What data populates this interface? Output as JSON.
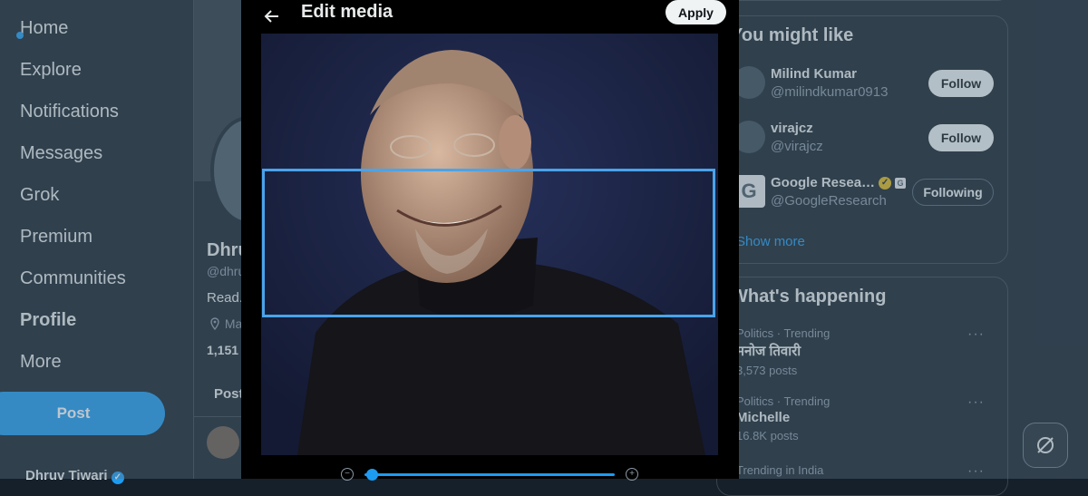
{
  "sidebar": {
    "items": [
      {
        "label": "Home"
      },
      {
        "label": "Explore"
      },
      {
        "label": "Notifications"
      },
      {
        "label": "Messages"
      },
      {
        "label": "Grok"
      },
      {
        "label": "Premium"
      },
      {
        "label": "Communities"
      },
      {
        "label": "Profile"
      },
      {
        "label": "More"
      }
    ],
    "post_label": "Post",
    "account_name": "Dhruv Tiwari"
  },
  "profile": {
    "name": "Dhru",
    "handle": "@dhru",
    "bio": "Read.",
    "location": "Ma",
    "count": "1,151 F",
    "tab": "Post"
  },
  "modal": {
    "title": "Edit media",
    "apply_label": "Apply",
    "zoom_minus": "−",
    "zoom_plus": "+",
    "zoom_level": 0.0
  },
  "who_to_follow": {
    "title": "You might like",
    "accounts": [
      {
        "name": "Milind Kumar",
        "handle": "@milindkumar0913",
        "button": "Follow"
      },
      {
        "name": "virajcz",
        "handle": "@virajcz",
        "button": "Follow"
      },
      {
        "name": "Google Resea…",
        "handle": "@GoogleResearch",
        "button": "Following",
        "avatar_letter": "G"
      }
    ],
    "show_more": "Show more"
  },
  "trending": {
    "title": "What's happening",
    "items": [
      {
        "meta": "Politics · Trending",
        "name": "मनोज तिवारी",
        "count": "3,573 posts"
      },
      {
        "meta": "Politics · Trending",
        "name": "Michelle",
        "count": "16.8K posts"
      },
      {
        "meta": "Trending in India",
        "name": "",
        "count": ""
      }
    ]
  },
  "colors": {
    "accent": "#1d9bf0",
    "crop_border": "#4aa3ea",
    "background": "#15202b"
  }
}
